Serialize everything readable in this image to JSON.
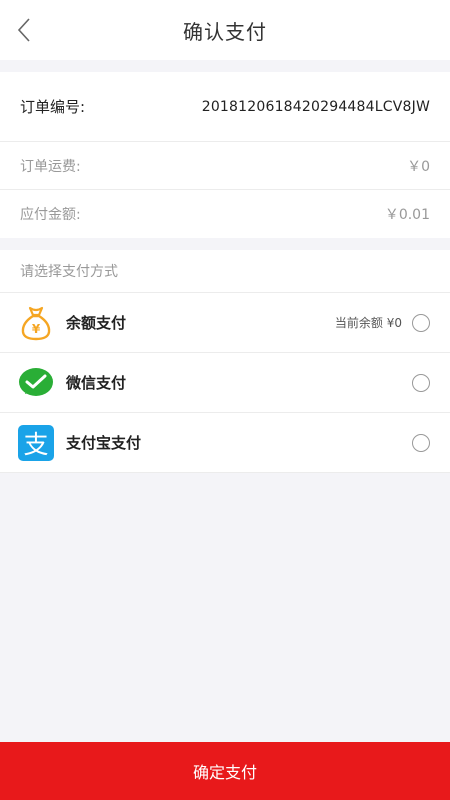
{
  "header": {
    "title": "确认支付",
    "back_icon": "chevron-left-icon"
  },
  "order": {
    "number_label": "订单编号:",
    "number_value": "201812061842029448​4LCV8JW",
    "shipping_label": "订单运费:",
    "shipping_value": "￥0",
    "amount_label": "应付金额:",
    "amount_value": "￥0.01"
  },
  "payment": {
    "prompt": "请选择支付方式",
    "methods": [
      {
        "label": "余额支付",
        "icon": "money-bag-icon",
        "extra": "当前余额 ¥0",
        "selected": false
      },
      {
        "label": "微信支付",
        "icon": "wechat-icon",
        "selected": false
      },
      {
        "label": "支付宝支付",
        "icon": "alipay-icon",
        "selected": false
      }
    ]
  },
  "footer": {
    "confirm_label": "确定支付"
  },
  "colors": {
    "accent": "#e8191b",
    "wechat": "#2aae36",
    "alipay": "#1aa3e8",
    "balance": "#f5a623"
  }
}
